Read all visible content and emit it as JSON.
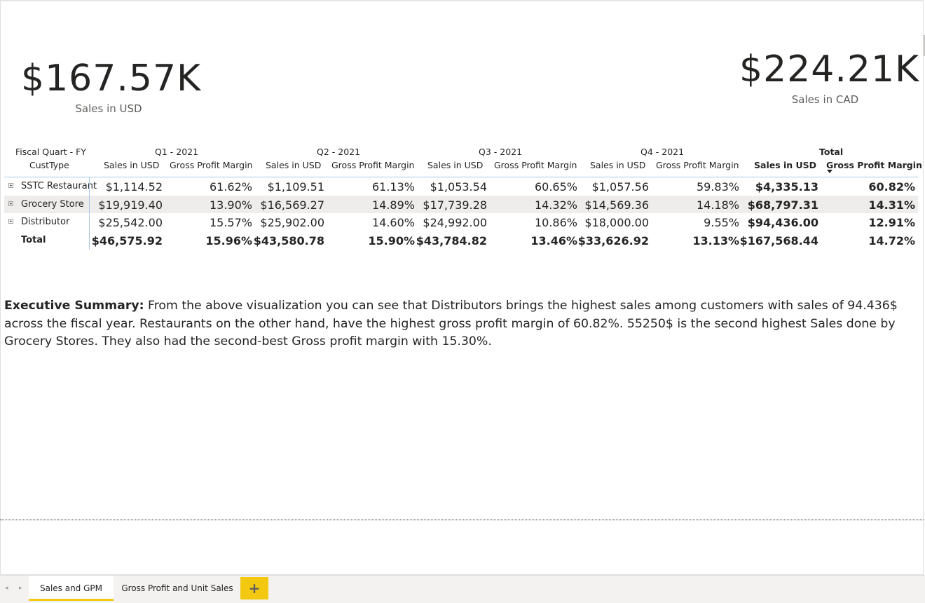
{
  "cards": {
    "usd": {
      "value": "$167.57K",
      "label": "Sales in USD"
    },
    "cad": {
      "value": "$224.21K",
      "label": "Sales in CAD"
    }
  },
  "matrix": {
    "row_header_line1": "Fiscal Quart - FY",
    "row_header_line2": "CustType",
    "quarters": [
      "Q1 - 2021",
      "Q2 - 2021",
      "Q3 - 2021",
      "Q4 - 2021"
    ],
    "total_header": "Total",
    "measure_sales": "Sales in USD",
    "measure_gpm": "Gross Profit Margin",
    "rows": [
      {
        "name": "SSTC Restaurant",
        "cells": [
          "$1,114.52",
          "61.62%",
          "$1,109.51",
          "61.13%",
          "$1,053.54",
          "60.65%",
          "$1,057.56",
          "59.83%",
          "$4,335.13",
          "60.82%"
        ]
      },
      {
        "name": "Grocery Store",
        "cells": [
          "$19,919.40",
          "13.90%",
          "$16,569.27",
          "14.89%",
          "$17,739.28",
          "14.32%",
          "$14,569.36",
          "14.18%",
          "$68,797.31",
          "14.31%"
        ]
      },
      {
        "name": "Distributor",
        "cells": [
          "$25,542.00",
          "15.57%",
          "$25,902.00",
          "14.60%",
          "$24,992.00",
          "10.86%",
          "$18,000.00",
          "9.55%",
          "$94,436.00",
          "12.91%"
        ]
      }
    ],
    "total_row": {
      "name": "Total",
      "cells": [
        "$46,575.92",
        "15.96%",
        "$43,580.78",
        "15.90%",
        "$43,784.82",
        "13.46%",
        "$33,626.92",
        "13.13%",
        "$167,568.44",
        "14.72%"
      ]
    }
  },
  "summary": {
    "heading": "Executive Summary:",
    "text": " From the above visualization you can see that Distributors brings the highest sales among customers with sales of 94.436$ across the fiscal year. Restaurants on the other hand, have the highest gross profit margin of 60.82%. 55250$ is the second highest Sales done by Grocery Stores. They also had the second-best Gross profit margin with 15.30%."
  },
  "tabs": {
    "items": [
      "Sales and GPM",
      "Gross Profit and Unit Sales"
    ],
    "add_label": "+",
    "prev_icon": "◂",
    "next_icon": "▸"
  },
  "colors": {
    "accent": "#f2c811"
  }
}
